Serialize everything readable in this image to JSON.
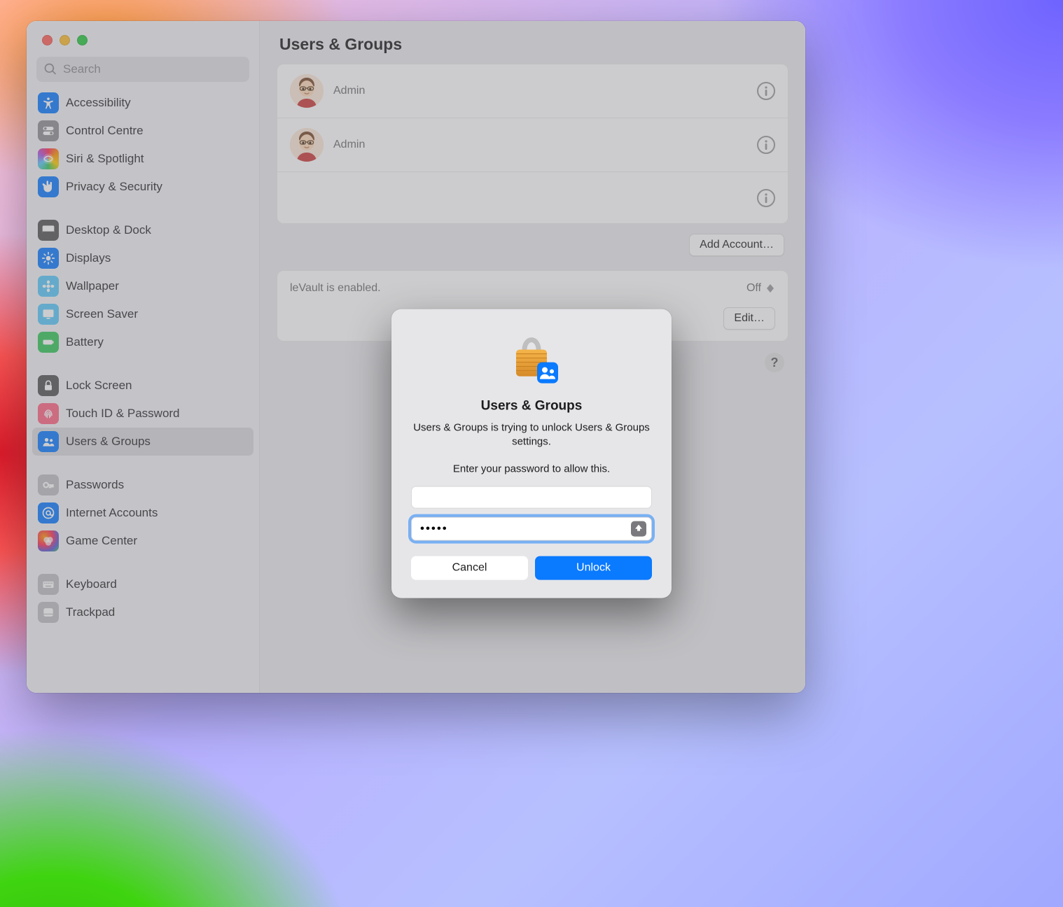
{
  "search": {
    "placeholder": "Search"
  },
  "sidebar": {
    "groups": [
      {
        "items": [
          {
            "label": "Accessibility",
            "icon": "accessibility",
            "tint": "ic-blue"
          },
          {
            "label": "Control Centre",
            "icon": "switches",
            "tint": "ic-gray"
          },
          {
            "label": "Siri & Spotlight",
            "icon": "siri",
            "tint": "ic-siri"
          },
          {
            "label": "Privacy & Security",
            "icon": "hand",
            "tint": "ic-blue"
          }
        ]
      },
      {
        "items": [
          {
            "label": "Desktop & Dock",
            "icon": "dock",
            "tint": "ic-darkgray"
          },
          {
            "label": "Displays",
            "icon": "sun",
            "tint": "ic-blue"
          },
          {
            "label": "Wallpaper",
            "icon": "flower",
            "tint": "ic-teal"
          },
          {
            "label": "Screen Saver",
            "icon": "screensaver",
            "tint": "ic-teal"
          },
          {
            "label": "Battery",
            "icon": "battery",
            "tint": "ic-green"
          }
        ]
      },
      {
        "items": [
          {
            "label": "Lock Screen",
            "icon": "lock",
            "tint": "ic-darkgray"
          },
          {
            "label": "Touch ID & Password",
            "icon": "fingerprint",
            "tint": "ic-pink"
          },
          {
            "label": "Users & Groups",
            "icon": "people",
            "tint": "ic-blue",
            "selected": true
          }
        ]
      },
      {
        "items": [
          {
            "label": "Passwords",
            "icon": "key",
            "tint": "ic-lgray"
          },
          {
            "label": "Internet Accounts",
            "icon": "at",
            "tint": "ic-blue"
          },
          {
            "label": "Game Center",
            "icon": "gamecenter",
            "tint": "ic-rainbow"
          }
        ]
      },
      {
        "items": [
          {
            "label": "Keyboard",
            "icon": "keyboard",
            "tint": "ic-lgray"
          },
          {
            "label": "Trackpad",
            "icon": "trackpad",
            "tint": "ic-lgray"
          }
        ]
      }
    ]
  },
  "main": {
    "title": "Users & Groups",
    "users": [
      {
        "role": "Admin"
      },
      {
        "role": "Admin"
      },
      {
        "role": ""
      }
    ],
    "add_account_label": "Add Account…",
    "auto_login": {
      "value": "Off",
      "hint": "leVault is enabled."
    },
    "network_server": {
      "edit_label": "Edit…"
    }
  },
  "dialog": {
    "title": "Users & Groups",
    "msg1": "Users & Groups is trying to unlock Users & Groups settings.",
    "msg2": "Enter your password to allow this.",
    "username_value": "",
    "password_value": "•••••",
    "cancel_label": "Cancel",
    "unlock_label": "Unlock"
  }
}
